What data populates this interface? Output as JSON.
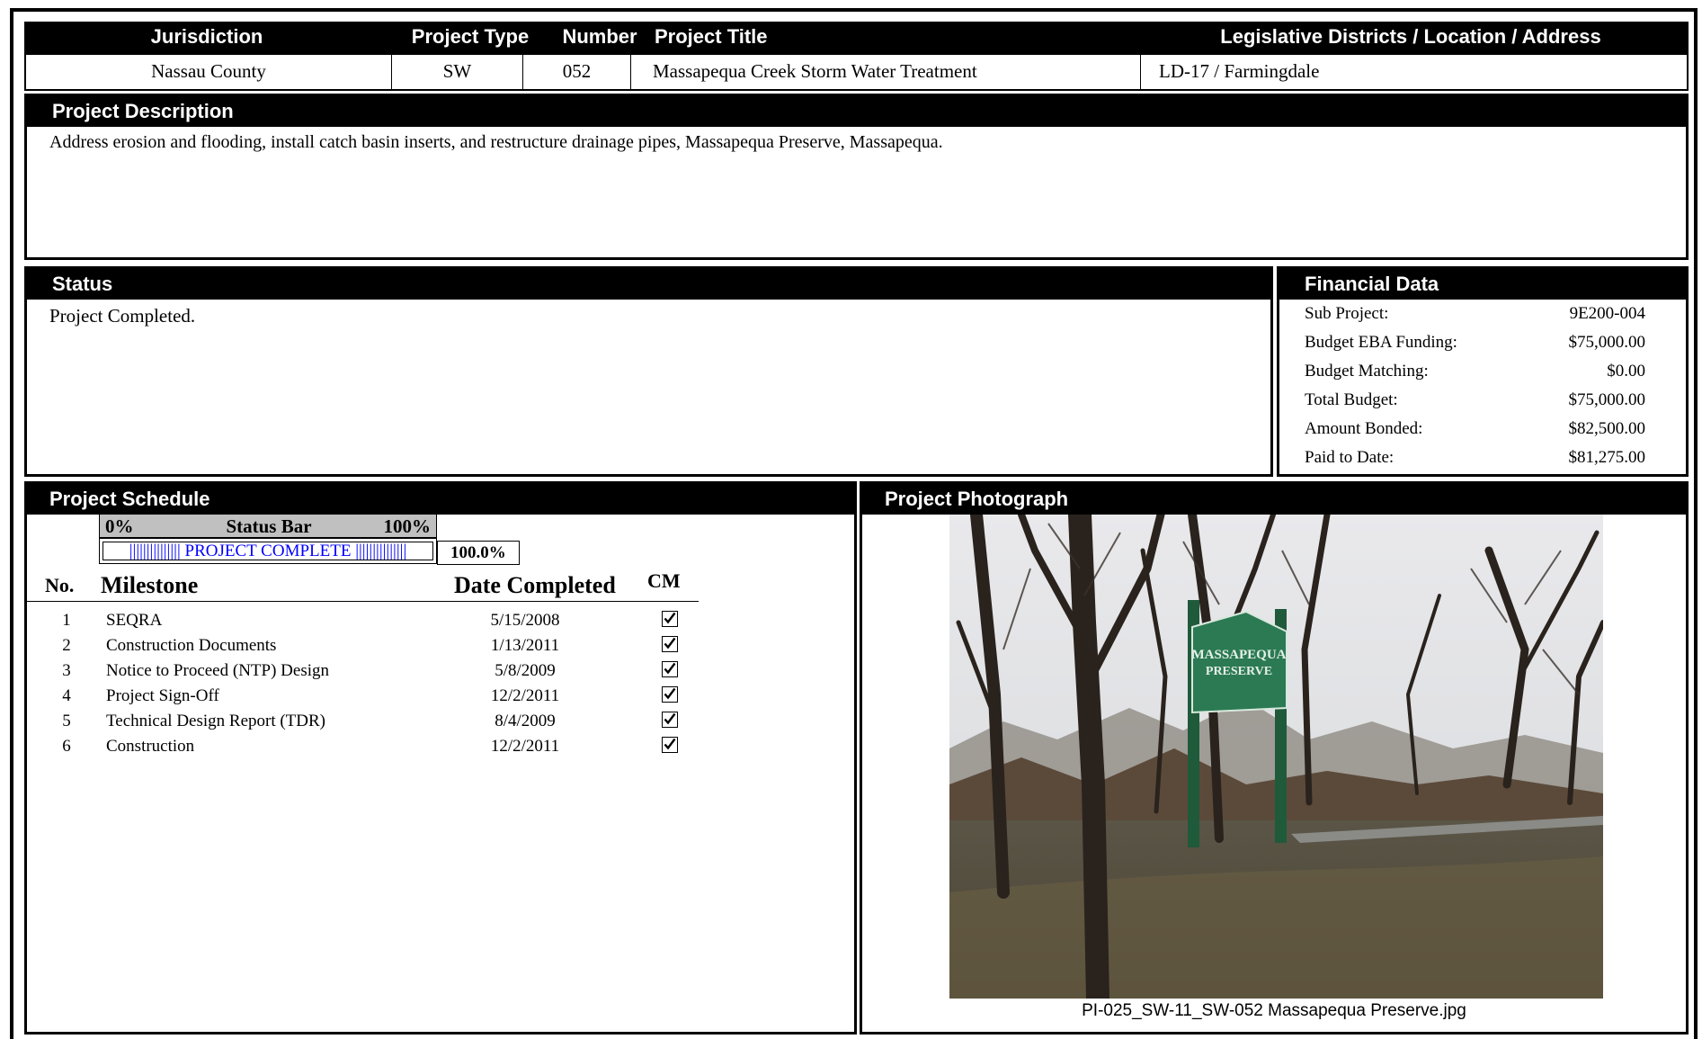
{
  "header": {
    "columns": [
      "Jurisdiction",
      "Project Type",
      "Number",
      "Project Title",
      "Legislative Districts / Location / Address"
    ],
    "values": [
      "Nassau County",
      "SW",
      "052",
      "Massapequa Creek Storm Water Treatment",
      "LD-17 / Farmingdale"
    ]
  },
  "description": {
    "title": "Project Description",
    "text": "Address erosion and flooding, install catch basin inserts, and restructure drainage pipes, Massapequa Preserve, Massapequa."
  },
  "status": {
    "title": "Status",
    "text": "Project Completed."
  },
  "financial": {
    "title": "Financial Data",
    "rows": [
      {
        "label": "Sub Project:",
        "value": "9E200-004"
      },
      {
        "label": "Budget EBA Funding:",
        "value": "$75,000.00"
      },
      {
        "label": "Budget Matching:",
        "value": "$0.00"
      },
      {
        "label": "Total Budget:",
        "value": "$75,000.00"
      },
      {
        "label": "Amount Bonded:",
        "value": "$82,500.00"
      },
      {
        "label": "Paid to Date:",
        "value": "$81,275.00"
      }
    ]
  },
  "schedule": {
    "title": "Project Schedule",
    "status_bar": {
      "left_label": "0%",
      "center_label": "Status Bar",
      "right_label": "100%",
      "bar_text": "||||||||||||||| PROJECT COMPLETE |||||||||||||||",
      "percent_text": "100.0%",
      "progress": 1.0
    },
    "columns": {
      "no": "No.",
      "milestone": "Milestone",
      "date": "Date Completed",
      "cm": "CM"
    },
    "milestones": [
      {
        "no": "1",
        "name": "SEQRA",
        "date": "5/15/2008",
        "cm": true
      },
      {
        "no": "2",
        "name": "Construction Documents",
        "date": "1/13/2011",
        "cm": true
      },
      {
        "no": "3",
        "name": "Notice to Proceed (NTP) Design",
        "date": "5/8/2009",
        "cm": true
      },
      {
        "no": "4",
        "name": "Project Sign-Off",
        "date": "12/2/2011",
        "cm": true
      },
      {
        "no": "5",
        "name": "Technical Design Report (TDR)",
        "date": "8/4/2009",
        "cm": true
      },
      {
        "no": "6",
        "name": "Construction",
        "date": "12/2/2011",
        "cm": true
      }
    ]
  },
  "photo": {
    "title": "Project Photograph",
    "caption": "PI-025_SW-11_SW-052 Massapequa Preserve.jpg",
    "sign_text": [
      "MASSAPEQUA",
      "PRESERVE"
    ]
  },
  "colors": {
    "header_bg": "#000000",
    "status_bar_bg": "#c0c0c0",
    "status_bar_text": "#0000ff"
  }
}
